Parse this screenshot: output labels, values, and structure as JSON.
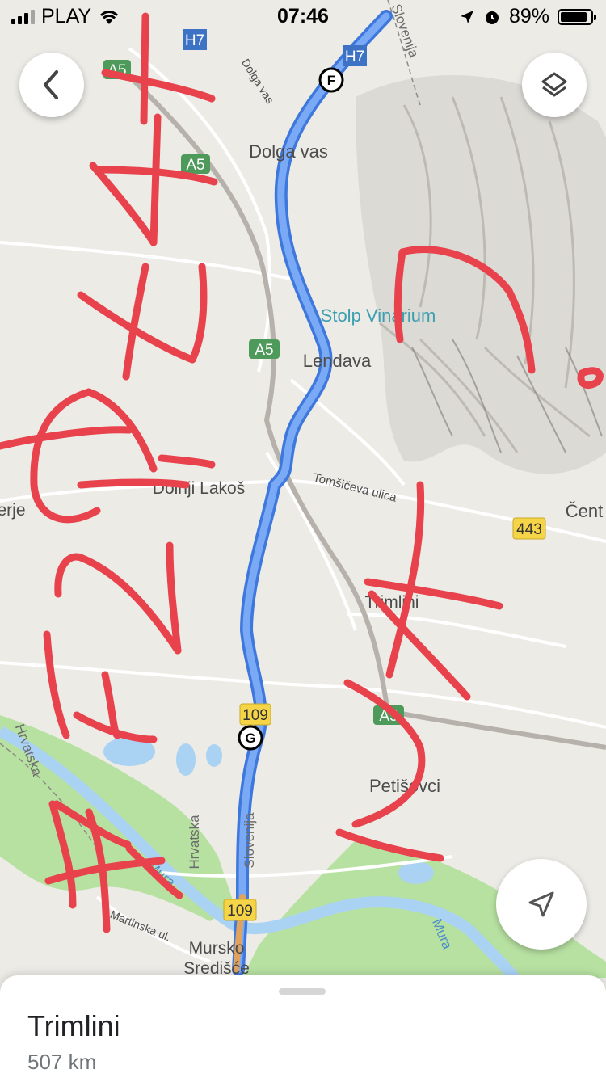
{
  "status_bar": {
    "carrier": "PLAY",
    "time": "07:46",
    "battery_percent": "89%",
    "battery_level": 0.89,
    "signal_bars": 3,
    "icons": [
      "signal-icon",
      "wifi-icon",
      "location-arrow-icon",
      "alarm-icon",
      "battery-icon"
    ]
  },
  "map": {
    "places": {
      "dolga_vas": "Dolga vas",
      "dolga_vas_road": "Dolga vas",
      "lendava": "Lendava",
      "stolp_vinarium": "Stolp Vinarium",
      "dolnji_lakos": "Dolnji Lakoš",
      "tomsiceva": "Tomšičeva ulica",
      "trimlini": "Trimlini",
      "petisovci": "Petišovci",
      "mursko_1": "Mursko",
      "mursko_2": "Središće",
      "martinska": "Martinska ul.",
      "cent": "Čent",
      "erje": "erje"
    },
    "borders": {
      "slovenija_top": "Slovenija",
      "slovenija_bottom": "Slovenija",
      "hrvatska_left": "Hrvatska",
      "hrvatska_mid": "Hrvatska"
    },
    "rivers": {
      "mura_1": "Mura",
      "mura_2": "Mura"
    },
    "shields": {
      "h7_1": "H7",
      "h7_2": "H7",
      "a5_1": "A5",
      "a5_2": "A5",
      "a5_3": "A5",
      "a5_4": "A5",
      "r443": "443",
      "r109_1": "109",
      "r109_2": "109"
    },
    "waypoints": {
      "f": "F",
      "g": "G"
    },
    "colors": {
      "route": "#6b9bf2",
      "route_outline": "#3f78dd",
      "annotation": "#e8424c",
      "park": "#b7e1a1",
      "water": "#aad3f3",
      "motorway_shield": "#4e9a5a",
      "h_shield": "#3d72c4",
      "yellow_shield": "#f5d547"
    }
  },
  "controls": {
    "back_icon": "chevron-left-icon",
    "layers_icon": "layers-icon",
    "location_icon": "navigation-arrow-icon"
  },
  "bottom_sheet": {
    "title": "Trimlini",
    "distance": "507 km"
  }
}
